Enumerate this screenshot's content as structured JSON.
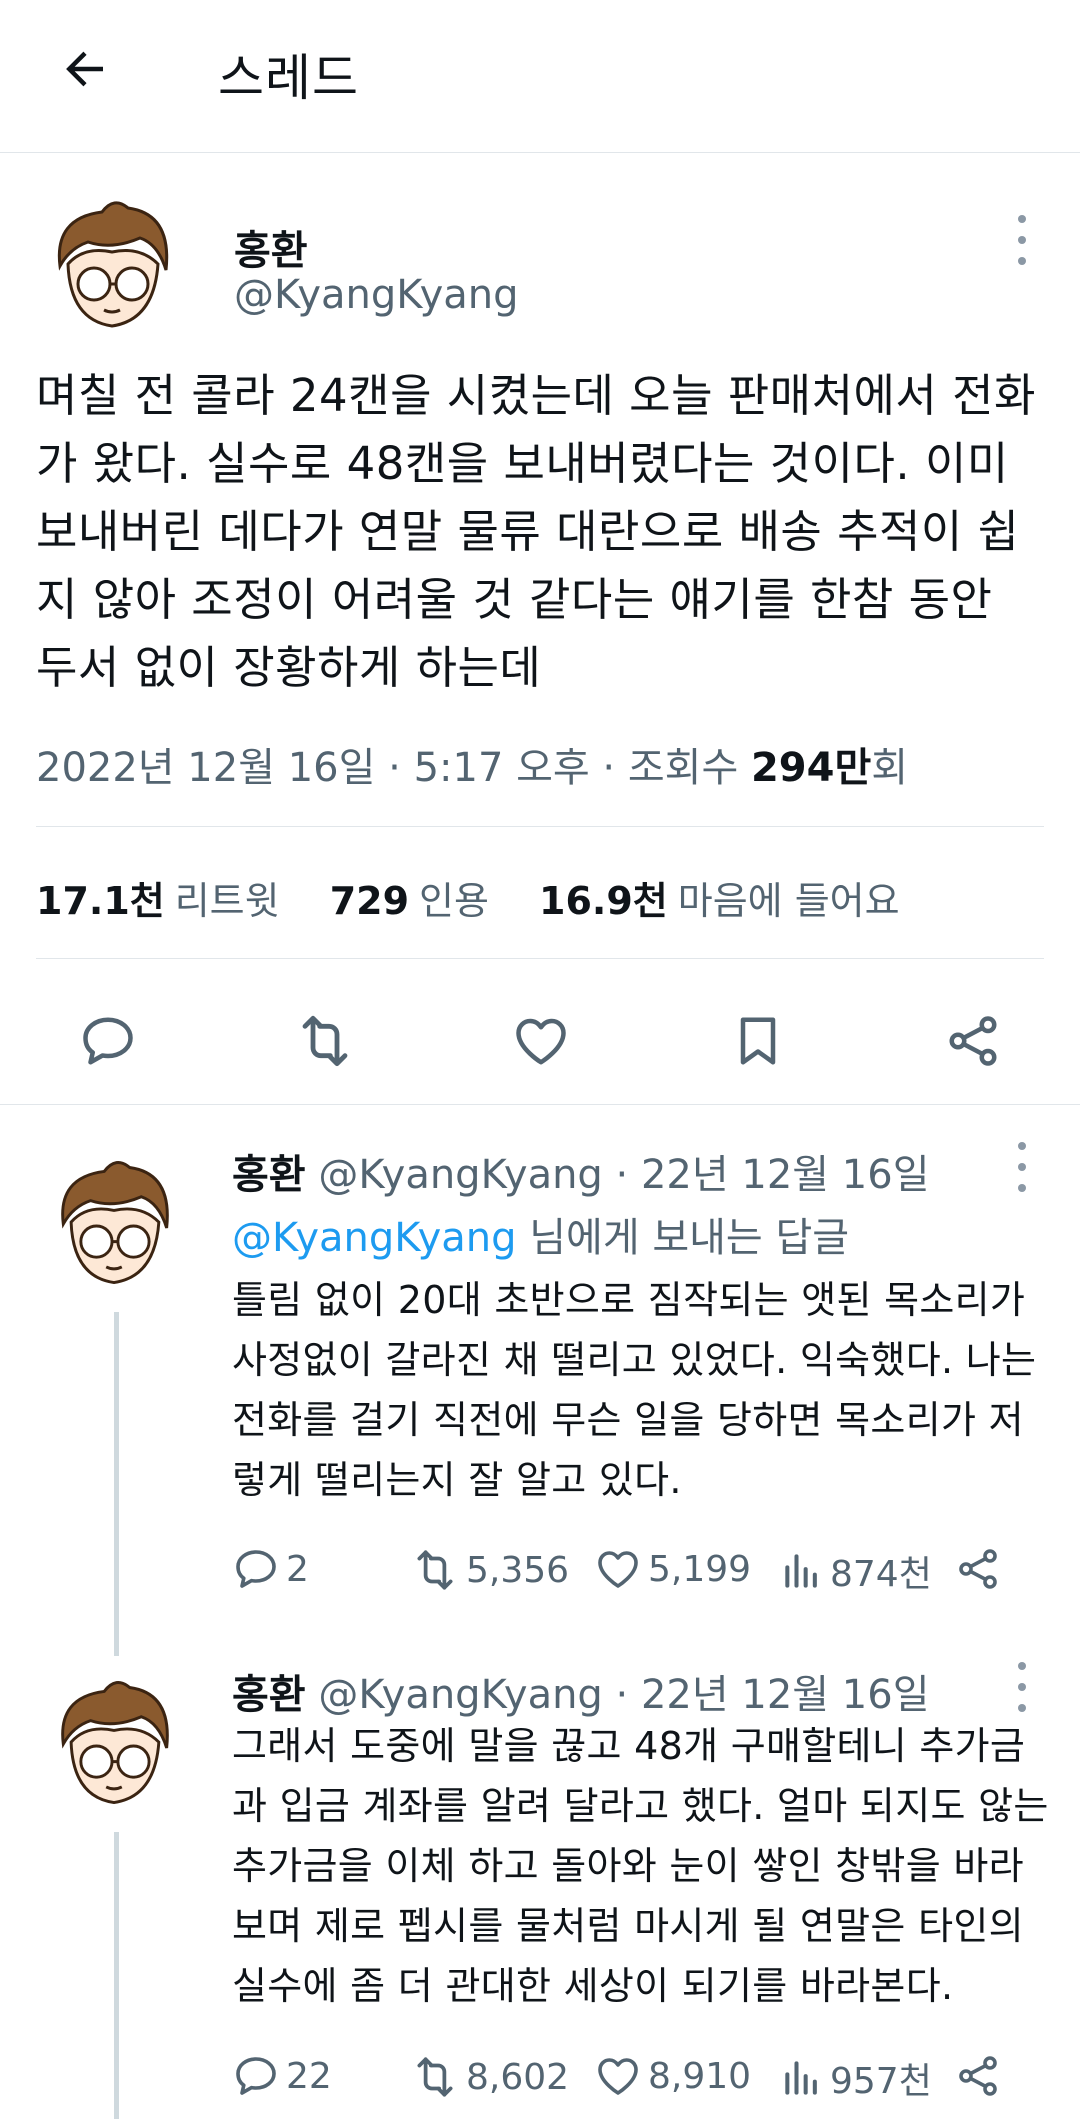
{
  "header": {
    "title": "스레드"
  },
  "tweet": {
    "author_name": "홍환",
    "author_handle": "@KyangKyang",
    "text": "며칠 전 콜라 24캔을 시켰는데 오늘 판매처에서 전화가 왔다. 실수로 48캔을 보내버렸다는 것이다. 이미 보내버린 데다가 연말 물류 대란으로 배송 추적이 쉽지 않아 조정이 어려울 것 같다는 얘기를 한참 동안 두서 없이 장황하게 하는데",
    "date": "2022년 12월 16일 · 5:17 오후 · 조회수 ",
    "views_number": "294만",
    "views_suffix": "회",
    "retweets_count": "17.1천",
    "retweets_label": "리트윗",
    "quotes_count": "729",
    "quotes_label": "인용",
    "likes_count": "16.9천",
    "likes_label": "마음에 들어요"
  },
  "replies": [
    {
      "author_name": "홍환",
      "author_handle": "@KyangKyang",
      "date": "· 22년 12월 16일",
      "reply_to_handle": "@KyangKyang",
      "reply_to_suffix": " 님에게 보내는 답글",
      "text": "틀림 없이 20대 초반으로 짐작되는 앳된 목소리가 사정없이 갈라진 채 떨리고 있었다. 익숙했다. 나는 전화를 걸기 직전에 무슨 일을 당하면 목소리가 저렇게 떨리는지 잘 알고 있다.",
      "comments": "2",
      "retweets": "5,356",
      "likes": "5,199",
      "views": "874천"
    },
    {
      "author_name": "홍환",
      "author_handle": "@KyangKyang",
      "date": "· 22년 12월 16일",
      "text": "그래서 도중에 말을 끊고 48개 구매할테니 추가금과 입금 계좌를 알려 달라고 했다. 얼마 되지도 않는 추가금을 이체 하고 돌아와 눈이 쌓인 창밖을 바라보며 제로 펩시를 물처럼 마시게 될 연말은 타인의 실수에 좀 더 관대한 세상이 되기를 바라본다.",
      "comments": "22",
      "retweets": "8,602",
      "likes": "8,910",
      "views": "957천"
    }
  ],
  "icons": {
    "back": "arrow-left-icon",
    "reply": "speech-bubble-icon",
    "retweet": "retweet-arrows-icon",
    "like": "heart-icon",
    "bookmark": "bookmark-icon",
    "share": "share-nodes-icon",
    "views": "bar-chart-icon",
    "more": "more-vertical-icon"
  },
  "colors": {
    "link": "#1d9bf0",
    "secondary_text": "#536471",
    "divider": "#e1e6ea"
  }
}
